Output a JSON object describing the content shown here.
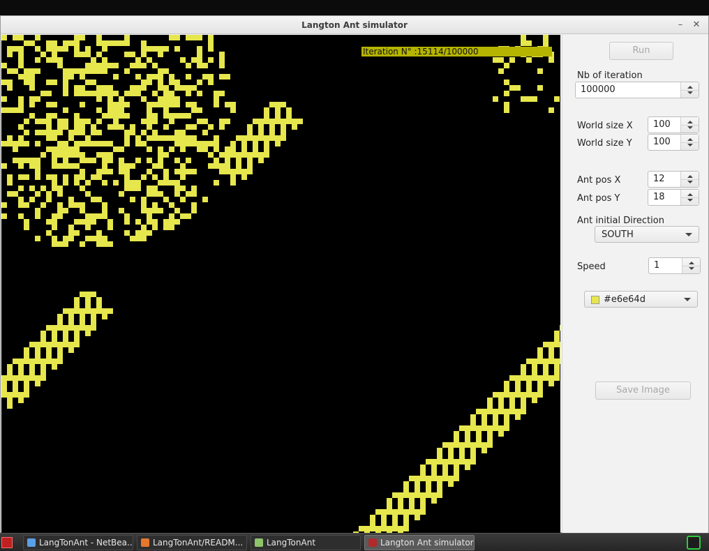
{
  "window": {
    "title": "Langton Ant simulator",
    "minimize_icon": "minimize-icon",
    "close_icon": "close-icon"
  },
  "canvas": {
    "iteration_label": "Iteration N° :15114/100000",
    "cell_color": "#e6e64d",
    "background_color": "#000000",
    "highlight_color": "#b5b400"
  },
  "panel": {
    "run_label": "Run",
    "iterations_label": "Nb of iteration",
    "iterations_value": "100000",
    "world_x_label": "World size X",
    "world_x_value": "100",
    "world_y_label": "World size Y",
    "world_y_value": "100",
    "ant_x_label": "Ant pos X",
    "ant_x_value": "12",
    "ant_y_label": "Ant pos Y",
    "ant_y_value": "18",
    "direction_label": "Ant initial Direction",
    "direction_value": "SOUTH",
    "speed_label": "Speed",
    "speed_value": "1",
    "color_value": "#e6e64d",
    "save_label": "Save Image"
  },
  "taskbar": {
    "items": [
      {
        "label": "LangTonAnt - NetBea...",
        "icon": "netbeans-icon",
        "color": "#5aa0e6"
      },
      {
        "label": "LangTonAnt/READM...",
        "icon": "firefox-icon",
        "color": "#e8772e"
      },
      {
        "label": "LangTonAnt",
        "icon": "folder-icon",
        "color": "#8fc46a"
      },
      {
        "label": "Langton Ant simulator",
        "icon": "java-app-icon",
        "color": "#b02a2a"
      }
    ]
  }
}
